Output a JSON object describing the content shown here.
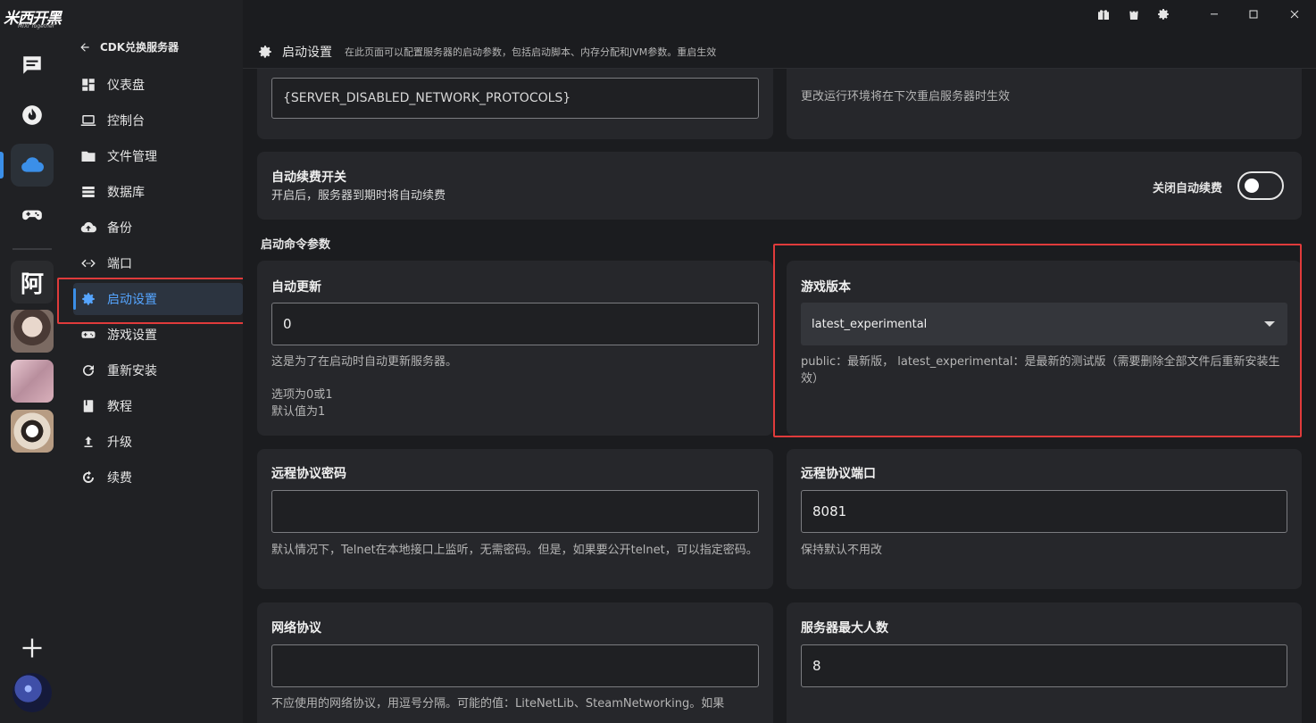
{
  "app": {
    "logo_main": "米西开黑",
    "logo_sub": "MIXI Together",
    "server_letter": "阿"
  },
  "nav": {
    "back_label": "CDK兑换服务器",
    "items": [
      {
        "label": "仪表盘",
        "icon": "dashboard-icon"
      },
      {
        "label": "控制台",
        "icon": "laptop-icon"
      },
      {
        "label": "文件管理",
        "icon": "folder-icon"
      },
      {
        "label": "数据库",
        "icon": "database-icon"
      },
      {
        "label": "备份",
        "icon": "cloud-upload-icon"
      },
      {
        "label": "端口",
        "icon": "code-arrows-icon"
      },
      {
        "label": "启动设置",
        "icon": "gear-icon",
        "active": true
      },
      {
        "label": "游戏设置",
        "icon": "gamepad-icon"
      },
      {
        "label": "重新安装",
        "icon": "refresh-icon"
      },
      {
        "label": "教程",
        "icon": "book-icon"
      },
      {
        "label": "升级",
        "icon": "upgrade-arrow-icon"
      },
      {
        "label": "续费",
        "icon": "renew-icon"
      }
    ]
  },
  "header": {
    "title": "启动设置",
    "description": "在此页面可以配置服务器的启动参数，包括启动脚本、内存分配和JVM参数。重启生效"
  },
  "top": {
    "protocols_value": "{SERVER_DISABLED_NETWORK_PROTOCOLS}",
    "runtime_note": "更改运行环境将在下次重启服务器时生效"
  },
  "autorenew": {
    "title": "自动续费开关",
    "desc": "开启后，服务器到期时将自动续费",
    "toggle_label": "关闭自动续费",
    "enabled": false
  },
  "section": {
    "title": "启动命令参数"
  },
  "cards": {
    "auto_update": {
      "title": "自动更新",
      "value": "0",
      "help1": "这是为了在启动时自动更新服务器。",
      "help2": "选项为0或1",
      "help3": "默认值为1"
    },
    "game_version": {
      "title": "游戏版本",
      "value": "latest_experimental",
      "help": "public：最新版， latest_experimental：是最新的测试版（需要删除全部文件后重新安装生效）"
    },
    "rcon_password": {
      "title": "远程协议密码",
      "value": "",
      "help": "默认情况下，Telnet在本地接口上监听，无需密码。但是，如果要公开telnet，可以指定密码。"
    },
    "rcon_port": {
      "title": "远程协议端口",
      "value": "8081",
      "help": "保持默认不用改"
    },
    "network_protocols": {
      "title": "网络协议",
      "value": "",
      "help": "不应使用的网络协议，用逗号分隔。可能的值：LiteNetLib、SteamNetworking。如果"
    },
    "max_players": {
      "title": "服务器最大人数",
      "value": "8"
    }
  },
  "colors": {
    "accent": "#3b8fe8",
    "highlight": "#e03b3b",
    "card": "#26272b",
    "background": "#1b1c1f"
  }
}
